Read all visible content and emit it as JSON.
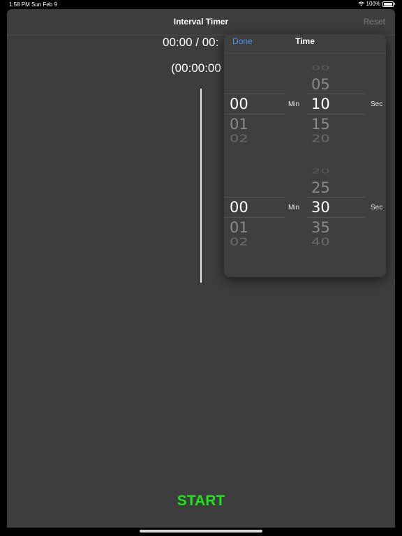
{
  "status_bar": {
    "time": "1:58 PM",
    "date": "Sun Feb 9",
    "battery": "100%"
  },
  "nav": {
    "title": "Interval Timer",
    "reset_label": "Reset"
  },
  "timer": {
    "main": "00:00 / 00:",
    "sub": "(00:00:00"
  },
  "start_label": "START",
  "popover": {
    "done_label": "Done",
    "title": "Time",
    "pickers": [
      {
        "min": {
          "selected": "00",
          "below": [
            "01",
            "02"
          ]
        },
        "min_unit": "Min",
        "sec": {
          "above": [
            "00",
            "05"
          ],
          "selected": "10",
          "below": [
            "15",
            "20"
          ]
        },
        "sec_unit": "Sec"
      },
      {
        "min": {
          "selected": "00",
          "below": [
            "01",
            "02"
          ]
        },
        "min_unit": "Min",
        "sec": {
          "above": [
            "20",
            "25"
          ],
          "selected": "30",
          "below": [
            "35",
            "40"
          ]
        },
        "sec_unit": "Sec"
      }
    ]
  },
  "colors": {
    "accent": "#4a8ef0",
    "start": "#1ee41e",
    "background": "#3d3d3d"
  }
}
